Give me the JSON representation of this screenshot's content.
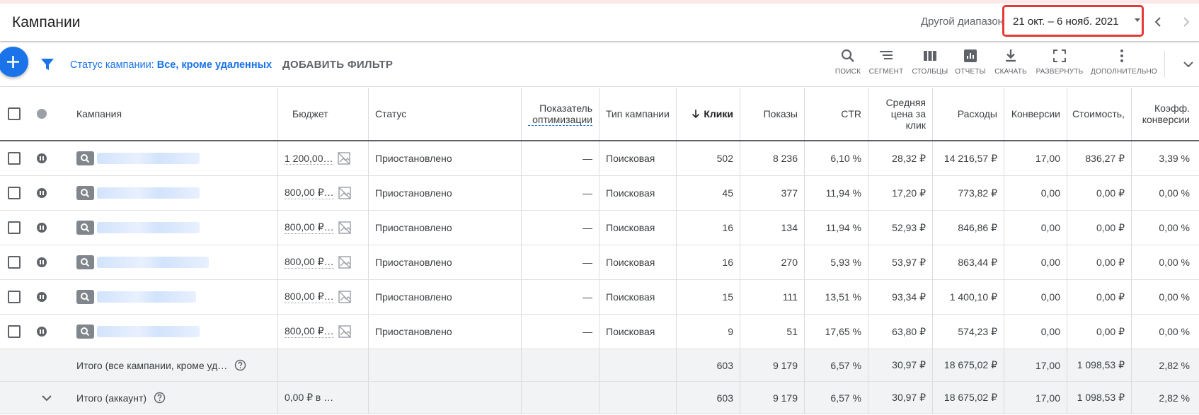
{
  "header": {
    "title": "Кампании",
    "range_label": "Другой диапазон",
    "date_range": "21 окт. – 6 нояб. 2021"
  },
  "toolbar": {
    "status_filter_prefix": "Статус кампании:",
    "status_filter_value": "Все, кроме удаленных",
    "add_filter": "ДОБАВИТЬ ФИЛЬТР",
    "tools": {
      "search": "ПОИСК",
      "segment": "СЕГМЕНТ",
      "columns": "СТОЛБЦЫ",
      "reports": "ОТЧЕТЫ",
      "download": "СКАЧАТЬ",
      "expand": "РАЗВЕРНУТЬ",
      "more": "ДОПОЛНИТЕЛЬНО"
    }
  },
  "table": {
    "columns": {
      "campaign": "Кампания",
      "budget": "Бюджет",
      "status": "Статус",
      "optimization": "Показатель оптимизации",
      "type": "Тип кампании",
      "clicks": "Клики",
      "impressions": "Показы",
      "ctr": "CTR",
      "avg_cpc": "Средняя цена за клик",
      "cost": "Расходы",
      "conversions": "Конверсии",
      "cost_per_conv": "Стоимость,",
      "conv_rate": "Коэфф. конверсии"
    },
    "rows": [
      {
        "budget": "1 200,00…",
        "status": "Приостановлено",
        "optimization": "—",
        "type": "Поисковая",
        "clicks": "502",
        "impressions": "8 236",
        "ctr": "6,10 %",
        "avg_cpc": "28,32 ₽",
        "cost": "14 216,57 ₽",
        "conversions": "17,00",
        "cost_per_conv": "836,27 ₽",
        "conv_rate": "3,39 %"
      },
      {
        "budget": "800,00 ₽…",
        "status": "Приостановлено",
        "optimization": "—",
        "type": "Поисковая",
        "clicks": "45",
        "impressions": "377",
        "ctr": "11,94 %",
        "avg_cpc": "17,20 ₽",
        "cost": "773,82 ₽",
        "conversions": "0,00",
        "cost_per_conv": "0,00 ₽",
        "conv_rate": "0,00 %"
      },
      {
        "budget": "800,00 ₽…",
        "status": "Приостановлено",
        "optimization": "—",
        "type": "Поисковая",
        "clicks": "16",
        "impressions": "134",
        "ctr": "11,94 %",
        "avg_cpc": "52,93 ₽",
        "cost": "846,86 ₽",
        "conversions": "0,00",
        "cost_per_conv": "0,00 ₽",
        "conv_rate": "0,00 %"
      },
      {
        "budget": "800,00 ₽…",
        "status": "Приостановлено",
        "optimization": "—",
        "type": "Поисковая",
        "clicks": "16",
        "impressions": "270",
        "ctr": "5,93 %",
        "avg_cpc": "53,97 ₽",
        "cost": "863,44 ₽",
        "conversions": "0,00",
        "cost_per_conv": "0,00 ₽",
        "conv_rate": "0,00 %"
      },
      {
        "budget": "800,00 ₽…",
        "status": "Приостановлено",
        "optimization": "—",
        "type": "Поисковая",
        "clicks": "15",
        "impressions": "111",
        "ctr": "13,51 %",
        "avg_cpc": "93,34 ₽",
        "cost": "1 400,10 ₽",
        "conversions": "0,00",
        "cost_per_conv": "0,00 ₽",
        "conv_rate": "0,00 %"
      },
      {
        "budget": "800,00 ₽…",
        "status": "Приостановлено",
        "optimization": "—",
        "type": "Поисковая",
        "clicks": "9",
        "impressions": "51",
        "ctr": "17,65 %",
        "avg_cpc": "63,80 ₽",
        "cost": "574,23 ₽",
        "conversions": "0,00",
        "cost_per_conv": "0,00 ₽",
        "conv_rate": "0,00 %"
      }
    ],
    "totals": [
      {
        "label": "Итого (все кампании, кроме уд…",
        "budget": "",
        "clicks": "603",
        "impressions": "9 179",
        "ctr": "6,57 %",
        "avg_cpc": "30,97 ₽",
        "cost": "18 675,02 ₽",
        "conversions": "17,00",
        "cost_per_conv": "1 098,53 ₽",
        "conv_rate": "2,82 %"
      },
      {
        "label": "Итого (аккаунт)",
        "budget": "0,00 ₽ в …",
        "clicks": "603",
        "impressions": "9 179",
        "ctr": "6,57 %",
        "avg_cpc": "30,97 ₽",
        "cost": "18 675,02 ₽",
        "conversions": "17,00",
        "cost_per_conv": "1 098,53 ₽",
        "conv_rate": "2,82 %"
      }
    ]
  },
  "colors": {
    "accent": "#1a73e8",
    "highlight_border": "#e53935",
    "total_bg": "#f1f3f4"
  }
}
